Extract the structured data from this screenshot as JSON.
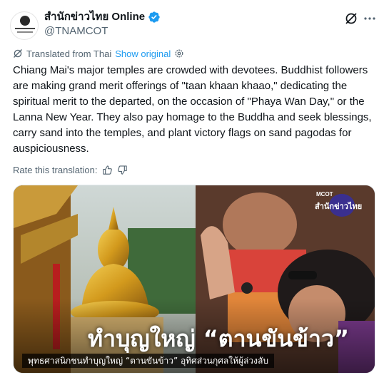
{
  "header": {
    "display_name": "สำนักข่าวไทย Online",
    "handle": "@TNAMCOT",
    "avatar_icon": "tnamcot-logo-icon",
    "verified_icon": "verified-badge-icon",
    "grok_icon": "grok-icon",
    "more_icon": "more-icon",
    "verified_color": "#1d9bf0"
  },
  "translation": {
    "translated_from": "Translated from Thai",
    "show_original": "Show original",
    "translate_icon": "translate-icon",
    "settings_icon": "gear-icon"
  },
  "tweet": {
    "text": "Chiang Mai's major temples are crowded with devotees. Buddhist followers are making grand merit offerings of \"taan khaan khaao,\" dedicating the spiritual merit to the departed, on the occasion of \"Phaya Wan Day,\" or the Lanna New Year. They also pay homage to the Buddha and seek blessings, carry sand into the temples, and plant victory flags on sand pagodas for auspiciousness."
  },
  "rating": {
    "label": "Rate this translation:",
    "thumbs_up_icon": "thumbs-up-icon",
    "thumbs_down_icon": "thumbs-down-icon"
  },
  "media": {
    "headline": "ทำบุญใหญ่ “ตานขันข้าว”",
    "caption": "พุทธศาสนิกชนทำบุญใหญ่ “ตานขันข้าว” อุทิศส่วนกุศลให้ผู้ล่วงลับ",
    "logo_top": "MCOT",
    "logo_label": "สำนักข่าวไทย"
  }
}
